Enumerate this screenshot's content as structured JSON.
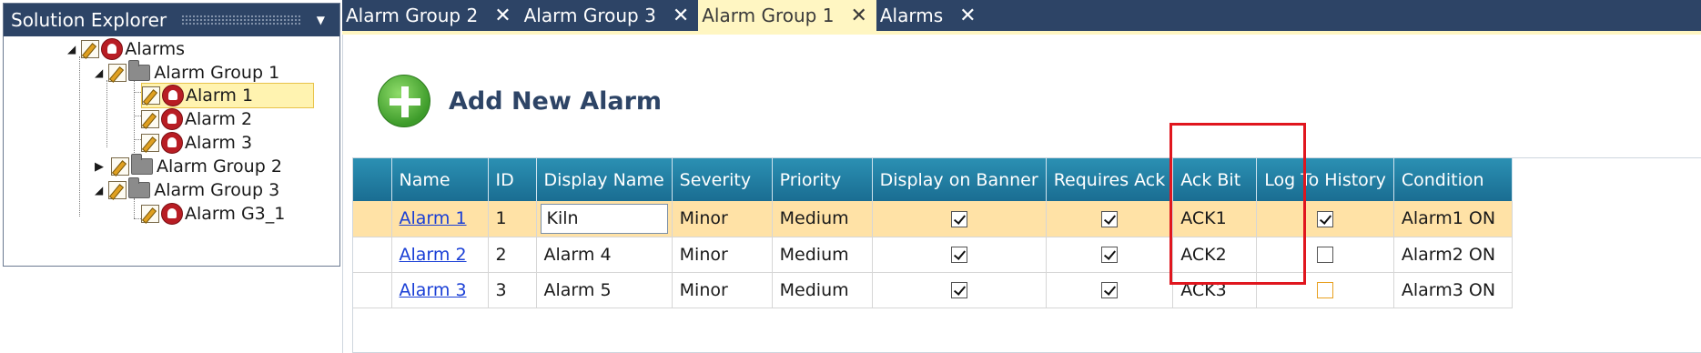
{
  "solution_explorer": {
    "title": "Solution Explorer",
    "tree": {
      "root": "Alarms",
      "group1": "Alarm Group 1",
      "alarm1": "Alarm 1",
      "alarm2": "Alarm 2",
      "alarm3": "Alarm 3",
      "group2": "Alarm Group 2",
      "group3": "Alarm Group 3",
      "alarm_g3_1": "Alarm G3_1"
    }
  },
  "tabs": [
    {
      "label": "Alarm Group 2",
      "close": "✕"
    },
    {
      "label": "Alarm Group 3",
      "close": "✕"
    },
    {
      "label": "Alarm Group 1",
      "close": "✕",
      "active": true
    },
    {
      "label": "Alarms",
      "close": "✕"
    }
  ],
  "toolbar": {
    "add_label": "Add New Alarm"
  },
  "grid": {
    "columns": [
      "Name",
      "ID",
      "Display Name",
      "Severity",
      "Priority",
      "Display on Banner",
      "Requires Ack",
      "Ack Bit",
      "Log To History",
      "Condition"
    ],
    "rows": [
      {
        "name": "Alarm 1",
        "id": "1",
        "display_name": "Kiln",
        "severity": "Minor",
        "priority": "Medium",
        "banner": true,
        "requires_ack": true,
        "ack_bit": "ACK1",
        "log_history": true,
        "condition": "Alarm1 ON"
      },
      {
        "name": "Alarm 2",
        "id": "2",
        "display_name": "Alarm 4",
        "severity": "Minor",
        "priority": "Medium",
        "banner": true,
        "requires_ack": true,
        "ack_bit": "ACK2",
        "log_history": false,
        "condition": "Alarm2 ON"
      },
      {
        "name": "Alarm 3",
        "id": "3",
        "display_name": "Alarm 5",
        "severity": "Minor",
        "priority": "Medium",
        "banner": true,
        "requires_ack": true,
        "ack_bit": "ACK3",
        "log_history": false,
        "condition": "Alarm3 ON"
      }
    ]
  },
  "colors": {
    "title_bar": "#2d4466",
    "header_blue": "#1f7ea3",
    "selected_row": "#ffe2a6",
    "highlight_box": "#e0161e"
  }
}
